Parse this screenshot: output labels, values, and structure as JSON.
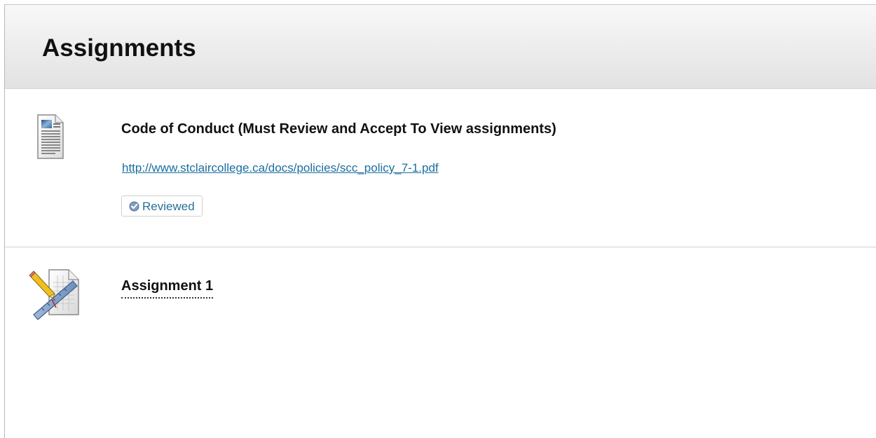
{
  "header": {
    "title": "Assignments"
  },
  "items": [
    {
      "icon": "document-icon",
      "title": "Code of Conduct (Must Review and Accept To View assignments)",
      "link_text": "http://www.stclaircollege.ca/docs/policies/scc_policy_7-1.pdf",
      "status": {
        "icon": "check-icon",
        "label": "Reviewed"
      }
    },
    {
      "icon": "assignment-icon",
      "title": "Assignment 1"
    }
  ],
  "colors": {
    "link": "#1a6ea0",
    "status_text": "#2a6f9a",
    "header_bg": "#ececec"
  }
}
